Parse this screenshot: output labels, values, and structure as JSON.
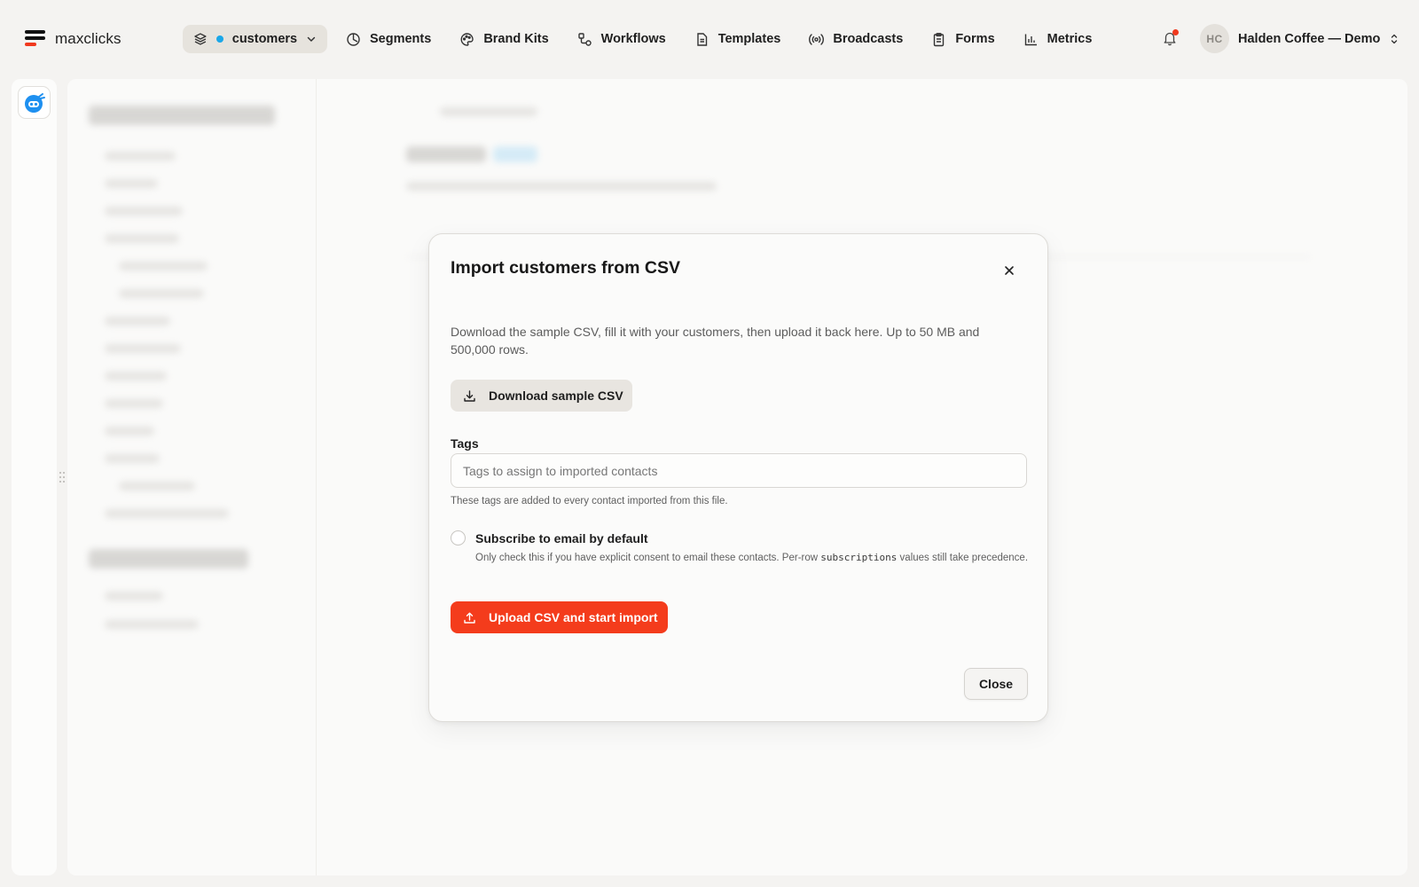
{
  "app": {
    "name": "maxclicks"
  },
  "colors": {
    "brand_accent": "#f0391e",
    "primary_button": "#f43c1c",
    "workspace_dot": "#1aa7e8"
  },
  "workspace": {
    "label": "customers",
    "icon": "layers-icon"
  },
  "nav": {
    "items": [
      {
        "label": "Segments",
        "icon": "segments-icon"
      },
      {
        "label": "Brand Kits",
        "icon": "palette-icon"
      },
      {
        "label": "Workflows",
        "icon": "workflow-icon"
      },
      {
        "label": "Templates",
        "icon": "document-icon"
      },
      {
        "label": "Broadcasts",
        "icon": "broadcast-icon"
      },
      {
        "label": "Forms",
        "icon": "clipboard-icon"
      },
      {
        "label": "Metrics",
        "icon": "bar-chart-icon"
      }
    ]
  },
  "account": {
    "initials": "HC",
    "name": "Halden Coffee — Demo"
  },
  "modal": {
    "title": "Import customers from CSV",
    "description": "Download the sample CSV, fill it with your customers, then upload it back here. Up to 50 MB and 500,000 rows.",
    "download_label": "Download sample CSV",
    "tags": {
      "label": "Tags",
      "value": "",
      "placeholder": "Tags to assign to imported contacts",
      "help": "These tags are added to every contact imported from this file."
    },
    "subscribe": {
      "label": "Subscribe to email by default",
      "checked": false,
      "help_before": "Only check this if you have explicit consent to email these contacts. Per-row ",
      "help_code": "subscriptions",
      "help_after": " values still take precedence."
    },
    "upload_label": "Upload CSV and start import",
    "close_label": "Close"
  }
}
